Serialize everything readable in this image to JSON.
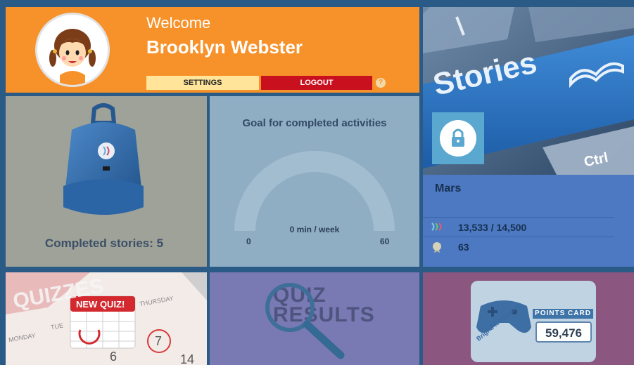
{
  "welcome": {
    "greeting": "Welcome",
    "user_name": "Brooklyn Webster",
    "settings_label": "SETTINGS",
    "logout_label": "LOGOUT",
    "help_label": "?"
  },
  "stories_tile": {
    "banner_text": "Stories",
    "key_label": "Ctrl"
  },
  "mars": {
    "title": "Mars",
    "points_text": "13,533 / 14,500",
    "badges_text": "63"
  },
  "backpack": {
    "completed_label": "Completed stories: 5"
  },
  "goal": {
    "title": "Goal for completed activities",
    "value_text": "0 min / week",
    "min_label": "0",
    "max_label": "60",
    "progress": 0
  },
  "quizzes": {
    "banner_text": "QUIZZES",
    "new_quiz_label": "NEW QUIZ!",
    "day_monday": "MONDAY",
    "day_tuesday": "TUE",
    "day_thursday": "THURSDAY",
    "date_seven": "7",
    "date_six": "6",
    "date_fourteen": "14"
  },
  "quiz_results": {
    "line_1": "QUIZ",
    "line_2": "RESULTS"
  },
  "points_card": {
    "label": "POINTS CARD",
    "value": "59,476",
    "brand": "BrightFishGaming"
  },
  "colors": {
    "welcome_bg": "#f7922a",
    "logout_bg": "#c8101e",
    "settings_bg": "#ffe49a",
    "mars_bg": "#4c79c2",
    "goal_bg": "#8fadc3",
    "backpack_bg": "#9ea299",
    "quiz_results_bg": "#7979b4",
    "points_bg": "#8b5680"
  }
}
